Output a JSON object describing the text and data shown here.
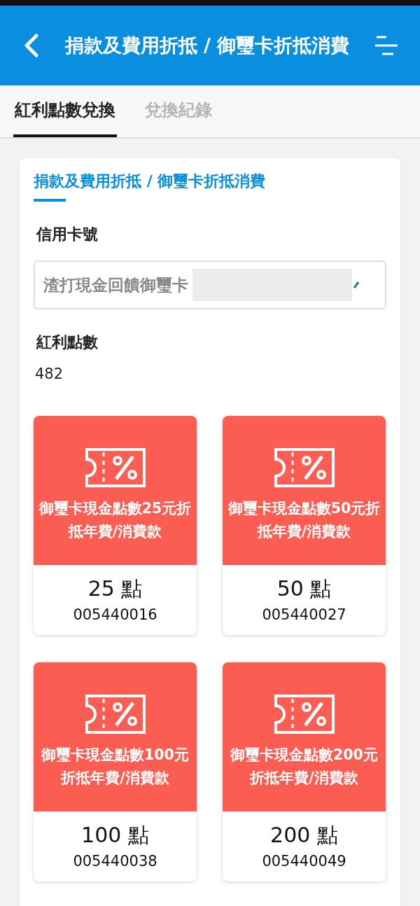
{
  "header": {
    "title": "捐款及費用折抵 / 御璽卡折抵消費"
  },
  "tabs": [
    {
      "label": "紅利點數兌換",
      "selected": true
    },
    {
      "label": "兌換紀錄",
      "selected": false
    }
  ],
  "panel": {
    "heading": "捐款及費用折抵 / 御璽卡折抵消費",
    "card_label": "信用卡號",
    "card_value": "渣打現金回饋御璽卡",
    "points_label": "紅利點數",
    "points_value": "482"
  },
  "rewards": [
    {
      "title": "御璽卡現金點數25元折抵年費/消費款",
      "points": "25 點",
      "code": "005440016"
    },
    {
      "title": "御璽卡現金點數50元折抵年費/消費款",
      "points": "50 點",
      "code": "005440027"
    },
    {
      "title": "御璽卡現金點數100元折抵年費/消費款",
      "points": "100 點",
      "code": "005440038"
    },
    {
      "title": "御璽卡現金點數200元折抵年費/消費款",
      "points": "200 點",
      "code": "005440049"
    }
  ]
}
